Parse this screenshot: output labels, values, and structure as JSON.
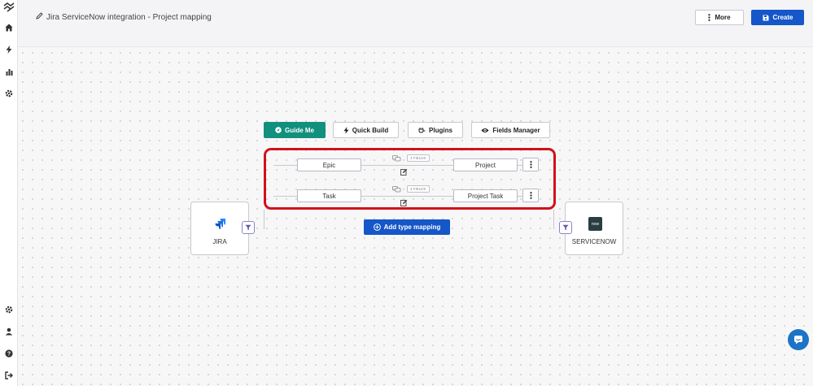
{
  "header": {
    "title": "Jira ServiceNow integration - Project mapping",
    "more_label": "More",
    "create_label": "Create"
  },
  "toolbar": {
    "guide_label": "Guide Me",
    "quick_build_label": "Quick Build",
    "plugins_label": "Plugins",
    "fields_manager_label": "Fields Manager"
  },
  "mappings": [
    {
      "source": "Epic",
      "target": "Project",
      "fields_badge": "4 FIELDS"
    },
    {
      "source": "Task",
      "target": "Project Task",
      "fields_badge": "4 FIELDS"
    }
  ],
  "left_endpoint": {
    "label": "JIRA"
  },
  "right_endpoint": {
    "label": "SERVICENOW",
    "logo_text": "now"
  },
  "add_mapping_label": "Add type mapping",
  "colors": {
    "primary": "#1556c9",
    "guide": "#11907d",
    "highlight": "#d0121b",
    "jira": "#2684ff",
    "servicenow_logo_bg": "#293e40"
  }
}
